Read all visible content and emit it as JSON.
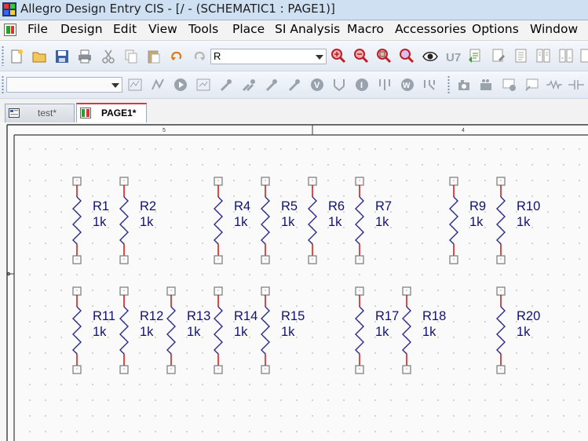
{
  "window": {
    "title": "Allegro Design Entry CIS - [/ - (SCHEMATIC1 : PAGE1)]"
  },
  "menubar": {
    "items": [
      "File",
      "Design",
      "Edit",
      "View",
      "Tools",
      "Place",
      "SI Analysis",
      "Macro",
      "Accessories",
      "Options",
      "Window"
    ]
  },
  "toolbar": {
    "part_combo_value": "R",
    "net_combo_value": "",
    "icons": [
      "new-icon",
      "open-icon",
      "save-icon",
      "print-icon",
      "cut-icon",
      "copy-icon",
      "paste-icon",
      "undo-icon",
      "redo-icon",
      "zoom-in-icon",
      "zoom-out-icon",
      "zoom-area-icon",
      "zoom-all-icon",
      "eye-icon",
      "u-icon",
      "netlist-icon",
      "drc-icon",
      "annotate-icon",
      "bom-icon",
      "back-annotate-icon",
      "cross-ref-icon"
    ]
  },
  "tabs": [
    {
      "label": "test*",
      "active": false
    },
    {
      "label": "PAGE1*",
      "active": true
    }
  ],
  "schematic": {
    "border_ticks": [
      "5",
      "4"
    ],
    "row1": [
      {
        "ref": "R1",
        "value": "1k"
      },
      {
        "ref": "R2",
        "value": "1k"
      },
      {
        "ref": "R4",
        "value": "1k"
      },
      {
        "ref": "R5",
        "value": "1k"
      },
      {
        "ref": "R6",
        "value": "1k"
      },
      {
        "ref": "R7",
        "value": "1k"
      },
      {
        "ref": "R9",
        "value": "1k"
      },
      {
        "ref": "R10",
        "value": "1k"
      }
    ],
    "row2": [
      {
        "ref": "R11",
        "value": "1k"
      },
      {
        "ref": "R12",
        "value": "1k"
      },
      {
        "ref": "R13",
        "value": "1k"
      },
      {
        "ref": "R14",
        "value": "1k"
      },
      {
        "ref": "R15",
        "value": "1k"
      },
      {
        "ref": "R17",
        "value": "1k"
      },
      {
        "ref": "R18",
        "value": "1k"
      },
      {
        "ref": "R20",
        "value": "1k"
      }
    ]
  },
  "colors": {
    "wire": "#cc0000",
    "pin_box": "#7a7a7a",
    "zigzag": "#2b2b8a",
    "label": "#12126e",
    "grid_dot": "#b8b8b8"
  }
}
